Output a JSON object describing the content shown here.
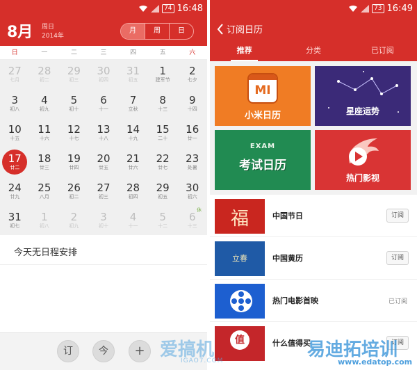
{
  "status_bar": {
    "left_battery": "74",
    "left_time": "16:48",
    "right_battery": "73",
    "right_time": "16:49"
  },
  "calendar": {
    "month": "8月",
    "week_label": "周日",
    "year_label": "2014年",
    "view_modes": [
      "月",
      "周",
      "日"
    ],
    "active_view": "月",
    "weekdays": [
      "日",
      "一",
      "二",
      "三",
      "四",
      "五",
      "六"
    ],
    "days": [
      {
        "n": "27",
        "l": "七月",
        "dim": true
      },
      {
        "n": "28",
        "l": "初二",
        "dim": true
      },
      {
        "n": "29",
        "l": "初三",
        "dim": true
      },
      {
        "n": "30",
        "l": "初四",
        "dim": true
      },
      {
        "n": "31",
        "l": "初五",
        "dim": true
      },
      {
        "n": "1",
        "l": "建军节"
      },
      {
        "n": "2",
        "l": "七夕"
      },
      {
        "n": "3",
        "l": "初八"
      },
      {
        "n": "4",
        "l": "初九"
      },
      {
        "n": "5",
        "l": "初十"
      },
      {
        "n": "6",
        "l": "十一"
      },
      {
        "n": "7",
        "l": "立秋"
      },
      {
        "n": "8",
        "l": "十三"
      },
      {
        "n": "9",
        "l": "十四"
      },
      {
        "n": "10",
        "l": "十五"
      },
      {
        "n": "11",
        "l": "十六"
      },
      {
        "n": "12",
        "l": "十七"
      },
      {
        "n": "13",
        "l": "十八"
      },
      {
        "n": "14",
        "l": "十九"
      },
      {
        "n": "15",
        "l": "二十"
      },
      {
        "n": "16",
        "l": "廿一"
      },
      {
        "n": "17",
        "l": "廿二",
        "selected": true
      },
      {
        "n": "18",
        "l": "廿三"
      },
      {
        "n": "19",
        "l": "廿四"
      },
      {
        "n": "20",
        "l": "廿五"
      },
      {
        "n": "21",
        "l": "廿六"
      },
      {
        "n": "22",
        "l": "廿七"
      },
      {
        "n": "23",
        "l": "处暑"
      },
      {
        "n": "24",
        "l": "廿九"
      },
      {
        "n": "25",
        "l": "八月"
      },
      {
        "n": "26",
        "l": "初二"
      },
      {
        "n": "27",
        "l": "初三"
      },
      {
        "n": "28",
        "l": "初四"
      },
      {
        "n": "29",
        "l": "初五"
      },
      {
        "n": "30",
        "l": "初六"
      },
      {
        "n": "31",
        "l": "初七"
      },
      {
        "n": "1",
        "l": "初八",
        "dim": true
      },
      {
        "n": "2",
        "l": "初九",
        "dim": true
      },
      {
        "n": "3",
        "l": "初十",
        "dim": true
      },
      {
        "n": "4",
        "l": "十一",
        "dim": true
      },
      {
        "n": "5",
        "l": "十二",
        "dim": true
      },
      {
        "n": "6",
        "l": "十三",
        "dim": true,
        "tag": "休"
      }
    ],
    "empty_message": "今天无日程安排",
    "bottom_buttons": [
      "订",
      "今",
      "+"
    ]
  },
  "subscribe": {
    "title": "订阅日历",
    "tabs": [
      "推荐",
      "分类",
      "已订阅"
    ],
    "active_tab": "推荐",
    "banners": [
      {
        "label": "小米日历",
        "logo": "MI"
      },
      {
        "label": "星座运势"
      },
      {
        "label": "考试日历",
        "logo": "EXAM"
      },
      {
        "label": "热门影视"
      }
    ],
    "items": [
      {
        "title": "中国节日",
        "action": "订阅",
        "thumb_text": "福"
      },
      {
        "title": "中国黄历",
        "action": "订阅",
        "thumb_text": "立春"
      },
      {
        "title": "热门电影首映",
        "action": "已订阅"
      },
      {
        "title": "什么值得买",
        "action": "订阅",
        "thumb_text": "值"
      }
    ]
  },
  "watermarks": [
    "爱搞机",
    "IGAO7.COM",
    "易迪拓培训",
    "www.edatop.com"
  ],
  "colors": {
    "accent": "#d62f2a",
    "grid_bg": "#f0f0f0",
    "holiday": "#7bb04a"
  }
}
